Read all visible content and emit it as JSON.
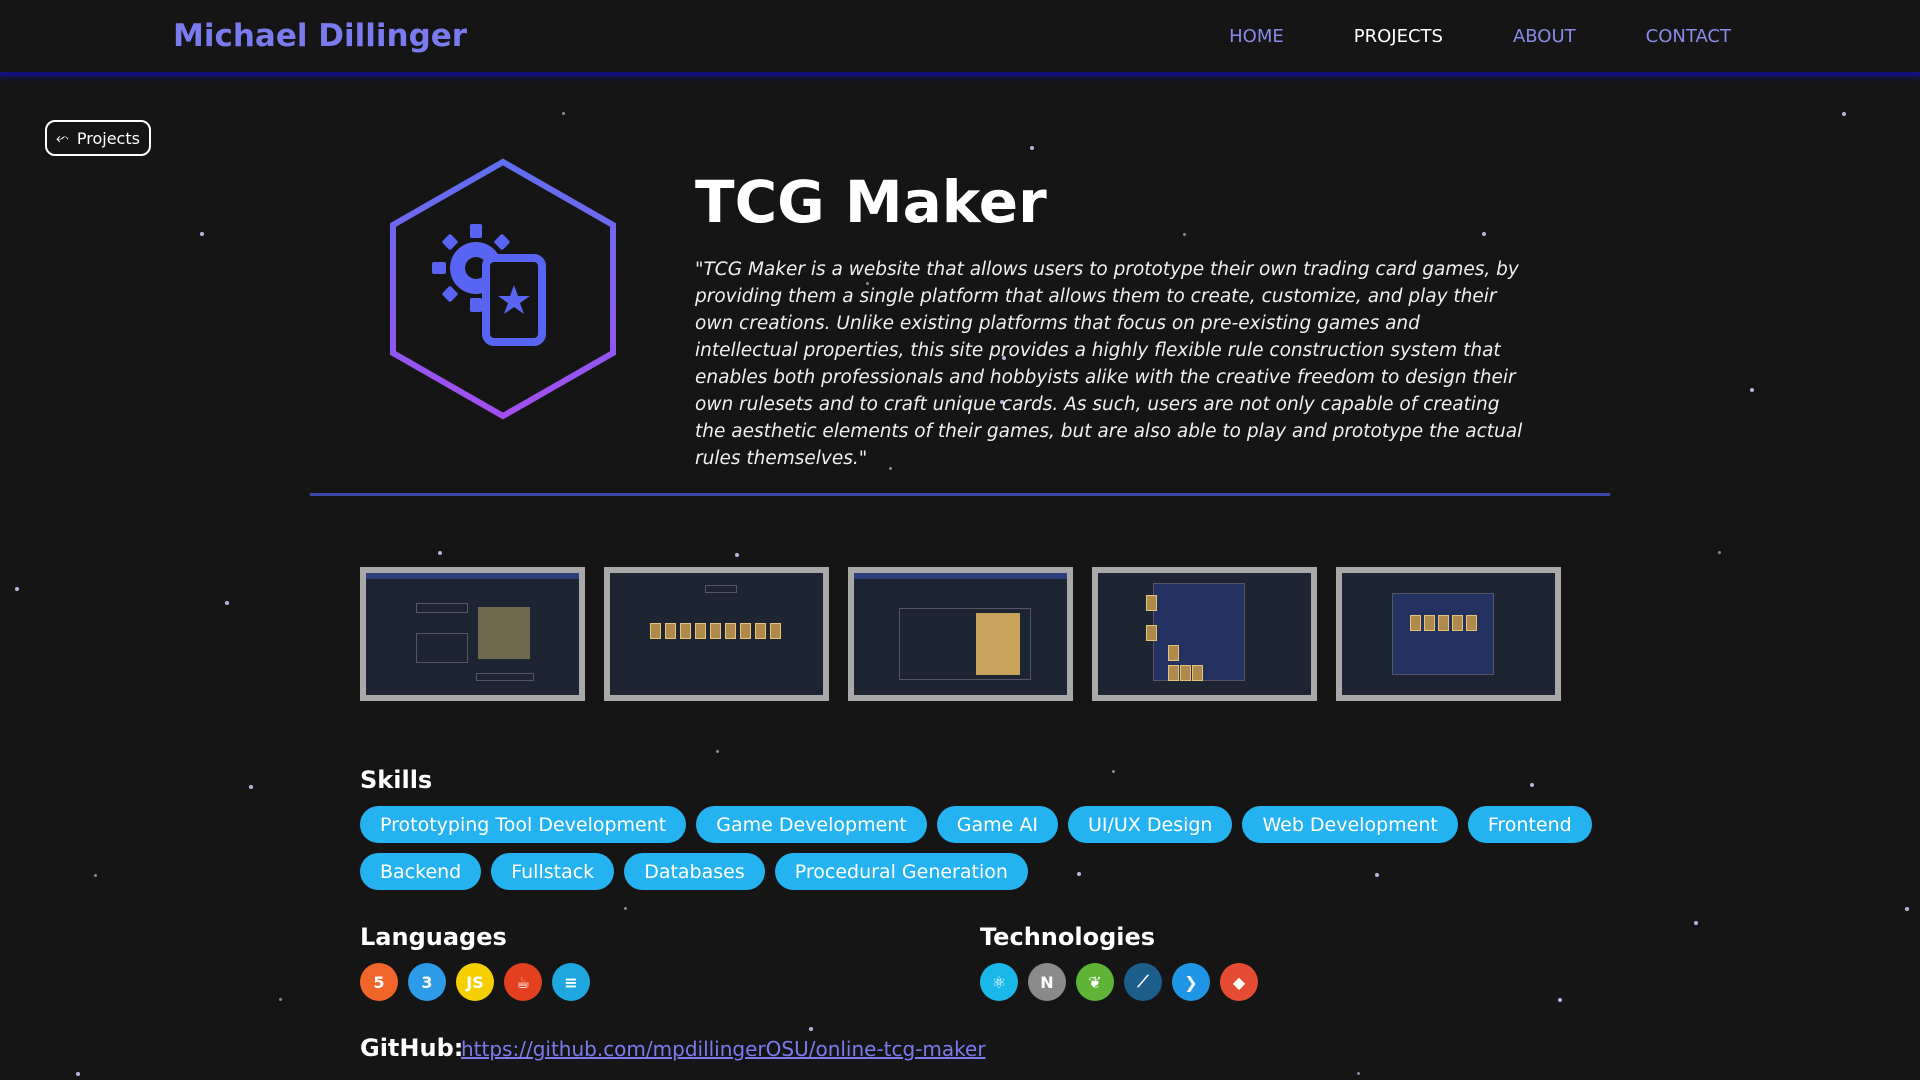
{
  "nav": {
    "brand": "Michael Dillinger",
    "links": [
      {
        "label": "HOME",
        "active": false
      },
      {
        "label": "PROJECTS",
        "active": true
      },
      {
        "label": "ABOUT",
        "active": false
      },
      {
        "label": "CONTACT",
        "active": false
      }
    ]
  },
  "back_button": {
    "label": "Projects",
    "icon": "arrow-left-icon"
  },
  "project": {
    "title": "TCG Maker",
    "logo_icon": "gear-card-icon",
    "description": "\"TCG Maker is a website that allows users to prototype their own trading card games, by providing them a single platform that allows them to create, customize, and play their own creations. Unlike existing platforms that focus on pre-existing games and intellectual properties, this site provides a highly flexible rule construction system that enables both professionals and hobbyists alike with the creative freedom to design their own rulesets and to craft unique cards. As such, users are not only capable of creating the aesthetic elements of their games, but are also able to play and prototype the actual rules themselves.\""
  },
  "screenshots": [
    {
      "variant": "workshop"
    },
    {
      "variant": "card-grid"
    },
    {
      "variant": "edit-card"
    },
    {
      "variant": "game-board"
    },
    {
      "variant": "modal-board"
    }
  ],
  "skills": {
    "title": "Skills",
    "rows": [
      [
        "Prototyping Tool Development",
        "Game Development",
        "Game AI",
        "UI/UX Design",
        "Web Development",
        "Frontend"
      ],
      [
        "Backend",
        "Fullstack",
        "Databases",
        "Procedural Generation"
      ]
    ]
  },
  "languages": {
    "title": "Languages",
    "icons": [
      {
        "name": "html5-icon",
        "glyph": "5",
        "color": "#f06529"
      },
      {
        "name": "css3-icon",
        "glyph": "3",
        "color": "#2d9be8"
      },
      {
        "name": "javascript-icon",
        "glyph": "JS",
        "color": "#f5d000"
      },
      {
        "name": "java-icon",
        "glyph": "☕",
        "color": "#e2401f"
      },
      {
        "name": "sql-icon",
        "glyph": "≡",
        "color": "#1fa8e0"
      }
    ]
  },
  "technologies": {
    "title": "Technologies",
    "icons": [
      {
        "name": "react-icon",
        "glyph": "⚛",
        "color": "#1ab8e8"
      },
      {
        "name": "nextjs-icon",
        "glyph": "N",
        "color": "#8a8a8a"
      },
      {
        "name": "spring-icon",
        "glyph": "❦",
        "color": "#5fb336"
      },
      {
        "name": "mysql-icon",
        "glyph": "⟋",
        "color": "#1c5d8a"
      },
      {
        "name": "vscode-icon",
        "glyph": "❯",
        "color": "#1f95e6"
      },
      {
        "name": "git-icon",
        "glyph": "◆",
        "color": "#e54c33"
      }
    ]
  },
  "github": {
    "label": "GitHub:",
    "url": "https://github.com/mpdillingerOSU/online-tcg-maker"
  },
  "colors": {
    "accent": "#7b7bf0",
    "pill": "#24b3f0",
    "background": "#151515",
    "divider": "#3a48a8"
  }
}
